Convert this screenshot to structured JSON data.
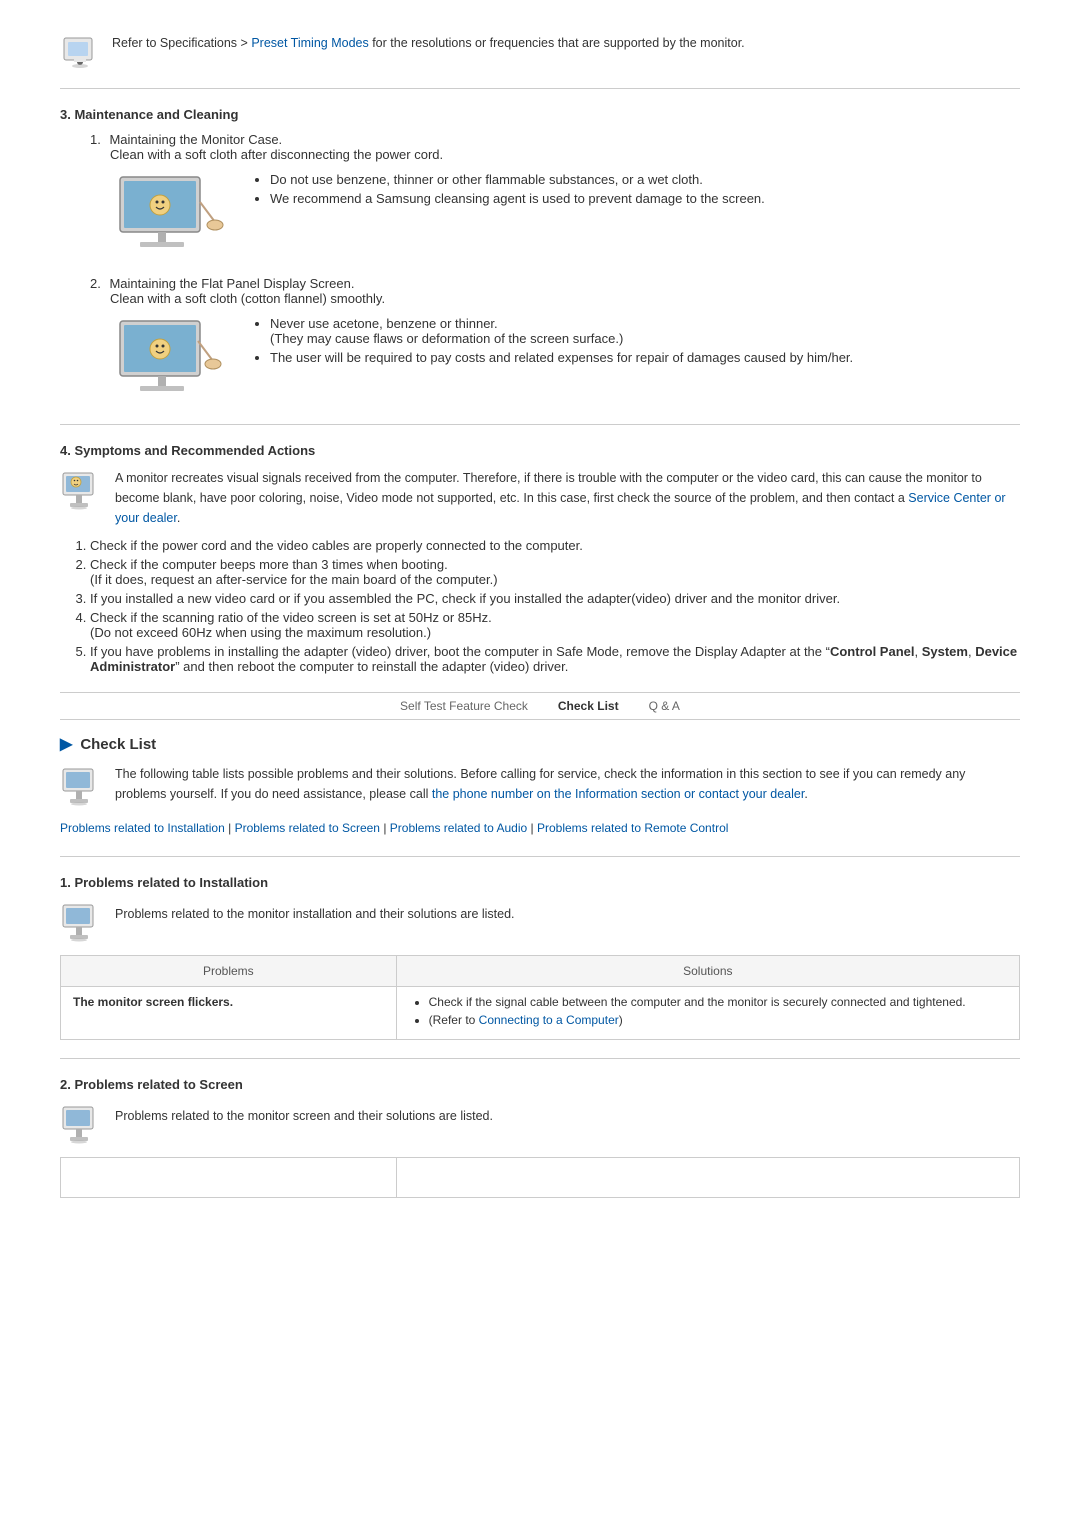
{
  "top_note": {
    "text": "Refer to Specifications > Preset Timing Modes for the resolutions or frequencies that are supported by the monitor.",
    "link_text": "Preset Timing Modes",
    "link_href": "#"
  },
  "section3": {
    "title": "3. Maintenance and Cleaning",
    "item1_title": "Maintaining the Monitor Case.",
    "item1_sub": "Clean with a soft cloth after disconnecting the power cord.",
    "item1_bullets": [
      "Do not use benzene, thinner or other flammable substances, or a wet cloth.",
      "We recommend a Samsung cleansing agent is used to prevent damage to the screen."
    ],
    "item2_title": "Maintaining the Flat Panel Display Screen.",
    "item2_sub": "Clean with a soft cloth (cotton flannel) smoothly.",
    "item2_bullets": [
      "Never use acetone, benzene or thinner.",
      "(They may cause flaws or deformation of the screen surface.)",
      "The user will be required to pay costs and related expenses for repair of damages caused by him/her."
    ]
  },
  "section4": {
    "title": "4. Symptoms and Recommended Actions",
    "intro": "A monitor recreates visual signals received from the computer. Therefore, if there is trouble with the computer or the video card, this can cause the monitor to become blank, have poor coloring, noise, Video mode not supported, etc. In this case, first check the source of the problem, and then contact a Service Center or your dealer.",
    "service_center_link": "Service Center or your dealer",
    "items": [
      "Check if the power cord and the video cables are properly connected to the computer.",
      "Check if the computer beeps more than 3 times when booting.\n(If it does, request an after-service for the main board of the computer.)",
      "If you installed a new video card or if you assembled the PC, check if you installed the adapter(video) driver and the monitor driver.",
      "Check if the scanning ratio of the video screen is set at 50Hz or 85Hz.\n(Do not exceed 60Hz when using the maximum resolution.)",
      "If you have problems in installing the adapter (video) driver, boot the computer in Safe Mode, remove the Display Adapter at the “Control Panel, System, Device Administrator” and then reboot the computer to reinstall the adapter (video) driver."
    ],
    "item5_bold": "Control Panel",
    "item5_bold2": "System",
    "item5_bold3": "Device Administrator"
  },
  "nav": {
    "items": [
      "Self Test Feature Check",
      "Check List",
      "Q & A"
    ],
    "active": "Check List"
  },
  "checklist": {
    "title": "Check List",
    "intro": "The following table lists possible problems and their solutions. Before calling for service, check the information in this section to see if you can remedy any problems yourself. If you do need assistance, please call the phone number on the Information section or contact your dealer.",
    "link_text": "the phone number on the Information section or contact your dealer",
    "links_row": "Problems related to Installation | Problems related to Screen | Problems related to Audio | Problems related to Remote Control",
    "links": [
      {
        "text": "Problems related to Installation",
        "href": "#"
      },
      {
        "text": "Problems related to Screen",
        "href": "#"
      },
      {
        "text": "Problems related to Audio",
        "href": "#"
      },
      {
        "text": "Problems related to Remote Control",
        "href": "#"
      }
    ]
  },
  "problems_installation": {
    "title": "1. Problems related to Installation",
    "intro": "Problems related to the monitor installation and their solutions are listed.",
    "table": {
      "col1": "Problems",
      "col2": "Solutions",
      "rows": [
        {
          "problem": "The monitor screen flickers.",
          "solutions": [
            "Check if the signal cable between the computer and the monitor is securely connected and tightened.",
            "(Refer to Connecting to a Computer)"
          ],
          "solution_link": "Connecting to a Computer"
        }
      ]
    }
  },
  "problems_screen": {
    "title": "2. Problems related to Screen",
    "intro": "Problems related to the monitor screen and their solutions are listed."
  }
}
